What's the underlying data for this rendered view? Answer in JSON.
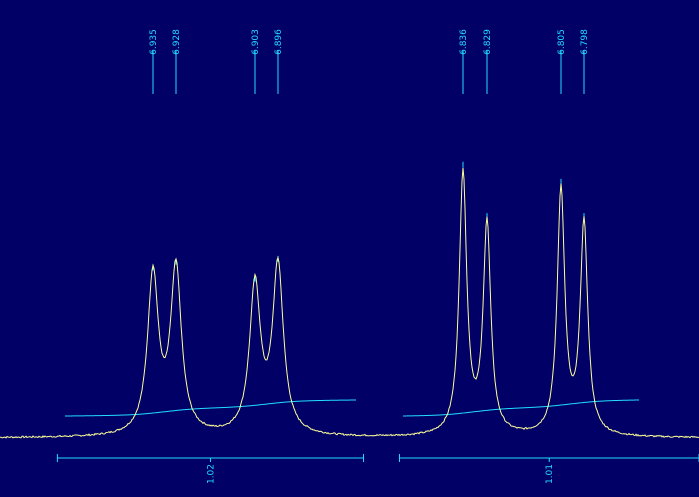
{
  "chart_data": {
    "type": "line",
    "title": "",
    "xlabel": "",
    "ylabel": "",
    "xlim": [
      6.77,
      6.975
    ],
    "ylim": [
      0,
      1
    ],
    "axis_reversed": true,
    "peaks": [
      {
        "label": "6.935",
        "ppm": 6.935,
        "height": 0.56
      },
      {
        "label": "6.928",
        "ppm": 6.928,
        "height": 0.58
      },
      {
        "label": "6.903",
        "ppm": 6.903,
        "height": 0.52
      },
      {
        "label": "6.896",
        "ppm": 6.896,
        "height": 0.59
      },
      {
        "label": "6.836",
        "ppm": 6.836,
        "height": 0.92
      },
      {
        "label": "6.829",
        "ppm": 6.829,
        "height": 0.74
      },
      {
        "label": "6.805",
        "ppm": 6.805,
        "height": 0.86
      },
      {
        "label": "6.798",
        "ppm": 6.798,
        "height": 0.74
      }
    ],
    "integrals": [
      {
        "label": "1.02",
        "range": [
          6.87,
          6.96
        ]
      },
      {
        "label": "1.01",
        "range": [
          6.77,
          6.857
        ]
      }
    ],
    "colors": {
      "background": "#000066",
      "spectrum_trace": "#ffff99",
      "labels_and_integrals": "#22ddff"
    }
  }
}
